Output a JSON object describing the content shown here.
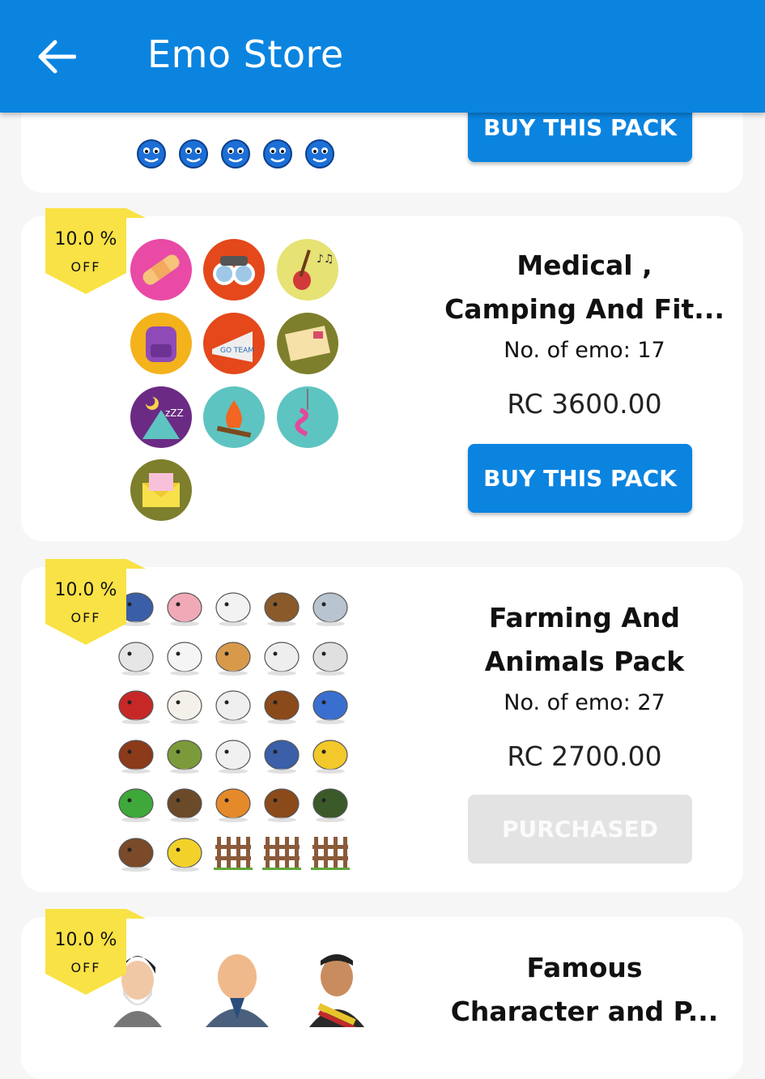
{
  "appbar": {
    "title": "Emo Store",
    "back_icon": "arrow-left-icon",
    "color": "#0b84e0"
  },
  "packs": [
    {
      "button_label": "BUY THIS PACK",
      "status": "buy"
    },
    {
      "badge": {
        "pct": "10.0 %",
        "off": "OFF",
        "color": "#f9e245"
      },
      "name": "Medical ,\nCamping And Fit...",
      "emo_count": "No. of emo: 17",
      "price": "RC 3600.00",
      "button_label": "BUY THIS PACK",
      "status": "buy",
      "icons": [
        "bandage-icon",
        "binoculars-icon",
        "guitar-icon",
        "backpack-icon",
        "megaphone-icon",
        "letter-icon",
        "tent-icon",
        "campfire-icon",
        "fishing-hook-icon",
        "envelope-icon"
      ]
    },
    {
      "badge": {
        "pct": "10.0 %",
        "off": "OFF",
        "color": "#f9e245"
      },
      "name": "Farming And\nAnimals Pack",
      "emo_count": "No. of emo: 27",
      "price": "RC 2700.00",
      "button_label": "PURCHASED",
      "status": "purchased"
    },
    {
      "badge": {
        "pct": "10.0 %",
        "off": "OFF",
        "color": "#f9e245"
      },
      "name": "Famous\nCharacter and P..."
    }
  ]
}
